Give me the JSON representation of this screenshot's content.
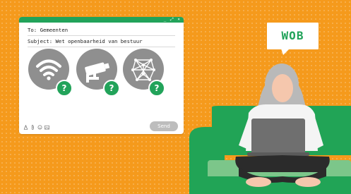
{
  "email": {
    "to_line": "To: Gemeenten",
    "subject_line": "Subject: Wet openbaarheid van bestuur",
    "window_controls": "_ ⤢ ×",
    "attachments": [
      {
        "icon": "wifi-icon"
      },
      {
        "icon": "security-camera-icon"
      },
      {
        "icon": "network-icon"
      }
    ],
    "badge_label": "?",
    "toolbar_icons": [
      "text-format-icon",
      "attach-icon",
      "emoji-icon",
      "image-icon"
    ],
    "send_label": "Send"
  },
  "bubble": {
    "text": "WOB"
  },
  "colors": {
    "background": "#f59a1c",
    "accent_green": "#22a35a",
    "sofa_green": "#21a456",
    "icon_grey": "#8f8f8f"
  }
}
